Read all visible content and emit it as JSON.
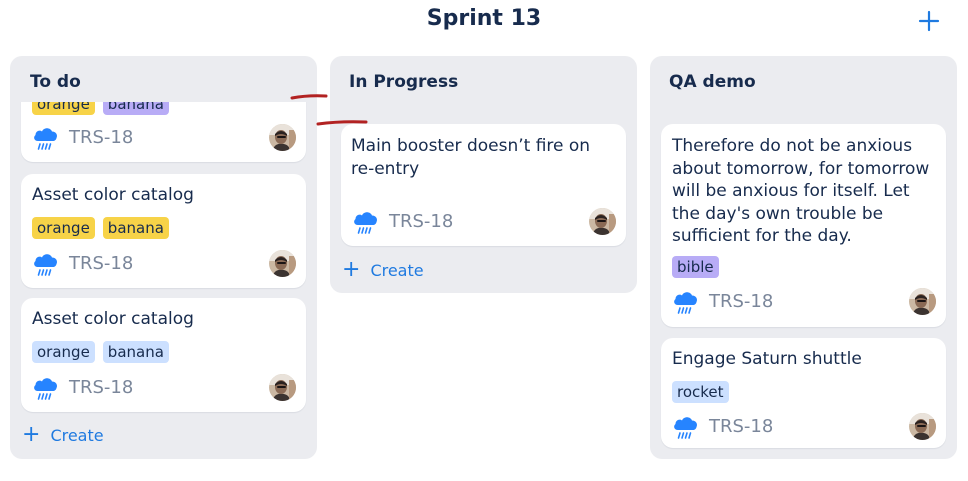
{
  "board": {
    "title": "Sprint 13",
    "add_icon": "plus-icon"
  },
  "colors": {
    "accent": "#1f7ae0",
    "column_bg": "#ebecf0",
    "label_yellow": "#f7d348",
    "label_purple": "#b8acf6",
    "label_blue": "#cce0ff",
    "annotation": "#b22222"
  },
  "columns": [
    {
      "title": "To do",
      "create_label": "Create",
      "cards": [
        {
          "title": "",
          "labels": [
            "orange",
            "banana"
          ],
          "key": "TRS-18"
        },
        {
          "title": "Asset color catalog",
          "labels": [
            "orange",
            "banana"
          ],
          "key": "TRS-18"
        },
        {
          "title": "Asset color catalog",
          "labels": [
            "orange",
            "banana"
          ],
          "key": "TRS-18"
        }
      ]
    },
    {
      "title": "In Progress",
      "create_label": "Create",
      "cards": [
        {
          "title_lines": [
            "Main booster doesn’t fire on",
            "re-entry"
          ],
          "key": "TRS-18"
        }
      ]
    },
    {
      "title": "QA demo",
      "cards": [
        {
          "title_lines": [
            "Therefore do not be anxious",
            "about tomorrow, for tomorrow",
            "will be anxious for itself. Let",
            "the day's own trouble be",
            "sufficient for the day."
          ],
          "labels": [
            "bible"
          ],
          "key": "TRS-18"
        },
        {
          "title": "Engage Saturn shuttle",
          "labels": [
            "rocket"
          ],
          "key": "TRS-18"
        }
      ]
    }
  ]
}
